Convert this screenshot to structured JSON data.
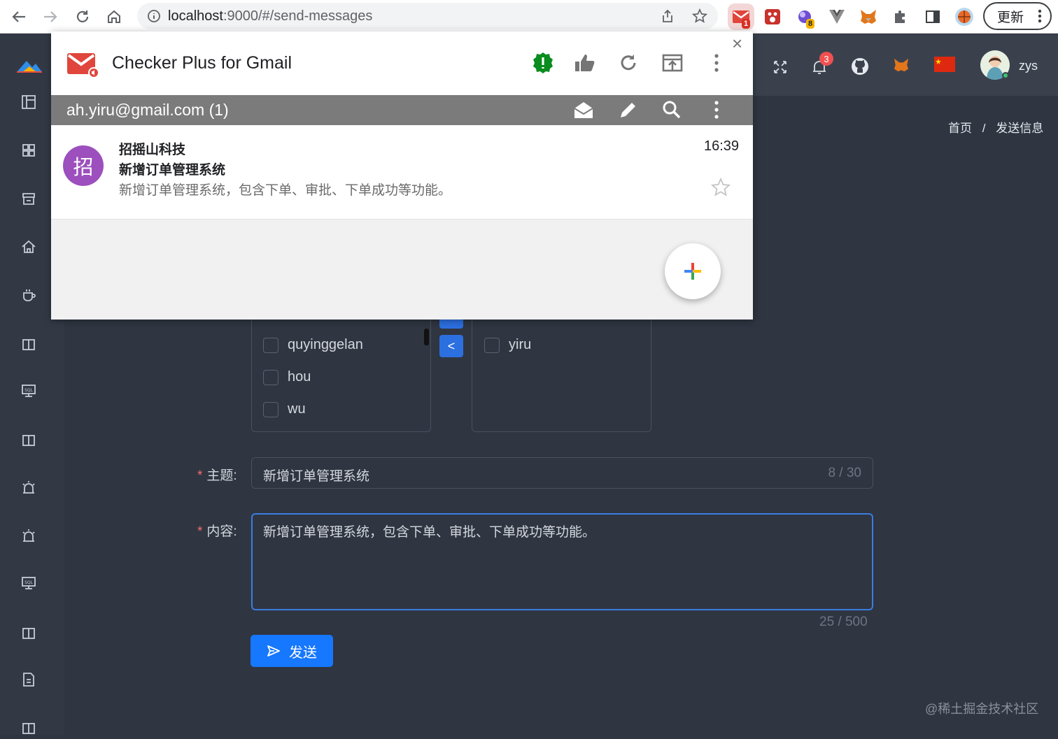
{
  "browser": {
    "url_host": "localhost",
    "url_path": ":9000/#/send-messages",
    "update_label": "更新",
    "gmail_badge": "1",
    "ext_badge": "8"
  },
  "header": {
    "notification_count": "3",
    "username": "zys"
  },
  "breadcrumb": {
    "home": "首页",
    "separator": "/",
    "current": "发送信息"
  },
  "transfer": {
    "left_items": [
      "quyinggelan",
      "hou",
      "wu"
    ],
    "right_items": [
      "yiru"
    ],
    "move_left_label": "<"
  },
  "form": {
    "required_mark": "*",
    "subject_label": "主题:",
    "subject_value": "新增订单管理系统",
    "subject_counter": "8 / 30",
    "content_label": "内容:",
    "content_value": "新增订单管理系统，包含下单、审批、下单成功等功能。",
    "content_counter": "25 / 500",
    "send_label": "发送"
  },
  "watermark": "@稀土掘金技术社区",
  "popup": {
    "title": "Checker Plus for Gmail",
    "account": "ah.yiru@gmail.com (1)",
    "close": "×",
    "mail": {
      "avatar_letter": "招",
      "from": "招摇山科技",
      "subject": "新增订单管理系统",
      "snippet": "新增订单管理系统，包含下单、审批、下单成功等功能。",
      "time": "16:39"
    }
  }
}
